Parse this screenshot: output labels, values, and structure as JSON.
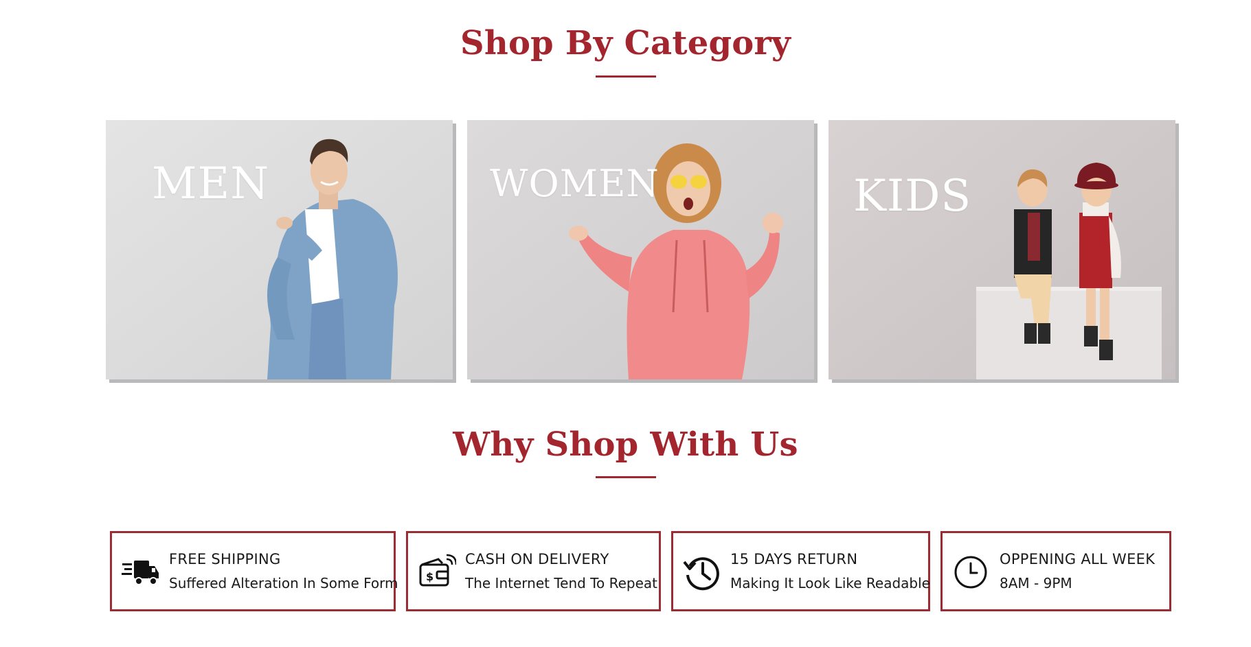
{
  "colors": {
    "accent": "#a3262e",
    "feature_border": "#9b2c33"
  },
  "shop_by_category": {
    "title": "Shop By Category",
    "categories": [
      {
        "label": "MEN",
        "image": "man-in-denim-shirt-pointing"
      },
      {
        "label": "WOMEN",
        "image": "woman-in-pink-hoodie-ok-sign"
      },
      {
        "label": "KIDS",
        "image": "two-kids-sitting-on-block"
      }
    ]
  },
  "why_shop": {
    "title": "Why Shop With Us",
    "features": [
      {
        "icon": "delivery-truck-icon",
        "title": "FREE SHIPPING",
        "subtitle": "Suffered Alteration In Some Form"
      },
      {
        "icon": "wallet-dollar-icon",
        "title": "CASH ON DELIVERY",
        "subtitle": "The Internet Tend To Repeat"
      },
      {
        "icon": "return-history-icon",
        "title": "15 DAYS RETURN",
        "subtitle": "Making It Look Like Readable"
      },
      {
        "icon": "clock-icon",
        "title": "OPPENING ALL WEEK",
        "subtitle": "8AM - 9PM"
      }
    ]
  }
}
